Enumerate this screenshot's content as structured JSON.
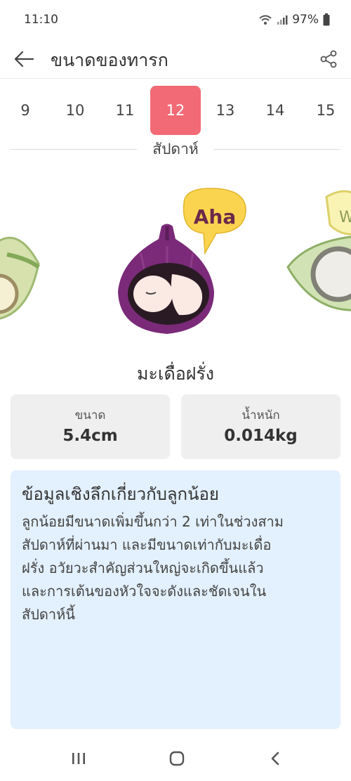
{
  "status_bar": {
    "time": "11:10",
    "battery": "97%"
  },
  "app_bar": {
    "title": "ขนาดของทารก"
  },
  "weeks": {
    "items": [
      "9",
      "10",
      "11",
      "12",
      "13",
      "14",
      "15"
    ],
    "selected": "12",
    "caption": "สัปดาห์"
  },
  "hero": {
    "bubble_text": "Aha",
    "side_bubble_text": "W"
  },
  "fruit": {
    "name": "มะเดื่อฝรั่ง"
  },
  "stats": {
    "size_label": "ขนาด",
    "size_value": "5.4cm",
    "weight_label": "น้ำหนัก",
    "weight_value": "0.014kg"
  },
  "insight": {
    "title": "ข้อมูลเชิงลึกเกี่ยวกับลูกน้อย",
    "lines": [
      "ลูกน้อยมีขนาดเพิ่มขึ้นกว่า 2 เท่าในช่วงสาม",
      "สัปดาห์ที่ผ่านมา และมีขนาดเท่ากับมะเดื่อ",
      "ฝรั่ง อวัยวะสำคัญส่วนใหญ่จะเกิดขึ้นแล้ว",
      "และการเต้นของหัวใจจะดังและชัดเจนใน",
      "สัปดาห์นี้"
    ]
  },
  "colors": {
    "accent": "#f26a75",
    "card_bg": "#efefef",
    "info_bg": "#e3f0fd",
    "fig": "#7a2a78"
  },
  "icons": [
    "back-arrow-icon",
    "share-icon",
    "wifi-icon",
    "signal-icon",
    "battery-icon",
    "recent-apps-icon",
    "home-icon",
    "back-nav-icon"
  ]
}
